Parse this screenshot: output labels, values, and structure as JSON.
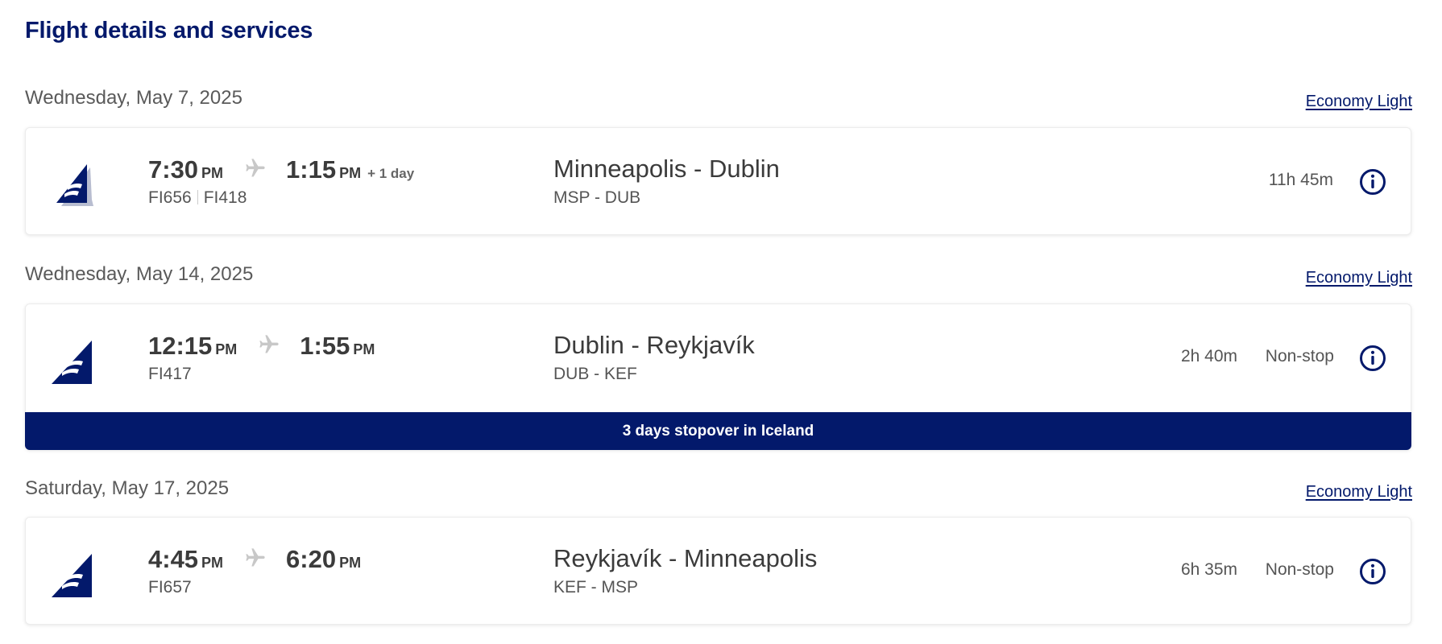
{
  "page": {
    "title": "Flight details and services"
  },
  "segments": [
    {
      "date": "Wednesday, May 7, 2025",
      "fare": "Economy Light",
      "depart_time": "7:30",
      "depart_ampm": "PM",
      "arrive_time": "1:15",
      "arrive_ampm": "PM",
      "arrive_plus": "+ 1 day",
      "flight_numbers": [
        "FI656",
        "FI418"
      ],
      "route": "Minneapolis - Dublin",
      "route_codes": "MSP - DUB",
      "duration": "11h 45m",
      "stops": ""
    },
    {
      "date": "Wednesday, May 14, 2025",
      "fare": "Economy Light",
      "depart_time": "12:15",
      "depart_ampm": "PM",
      "arrive_time": "1:55",
      "arrive_ampm": "PM",
      "arrive_plus": "",
      "flight_numbers": [
        "FI417"
      ],
      "route": "Dublin - Reykjavík",
      "route_codes": "DUB - KEF",
      "duration": "2h 40m",
      "stops": "Non-stop",
      "banner": "3 days stopover in Iceland"
    },
    {
      "date": "Saturday, May 17, 2025",
      "fare": "Economy Light",
      "depart_time": "4:45",
      "depart_ampm": "PM",
      "arrive_time": "6:20",
      "arrive_ampm": "PM",
      "arrive_plus": "",
      "flight_numbers": [
        "FI657"
      ],
      "route": "Reykjavík - Minneapolis",
      "route_codes": "KEF - MSP",
      "duration": "6h 35m",
      "stops": "Non-stop"
    }
  ],
  "icons": {
    "airline_logo": "icelandair-tail-logo-icon",
    "plane": "airplane-icon",
    "info": "info-circle-icon"
  },
  "colors": {
    "brand_navy": "#03196b",
    "text_dark": "#3b3b3b",
    "text_muted": "#555555",
    "plane_gray": "#c8c8c8"
  }
}
